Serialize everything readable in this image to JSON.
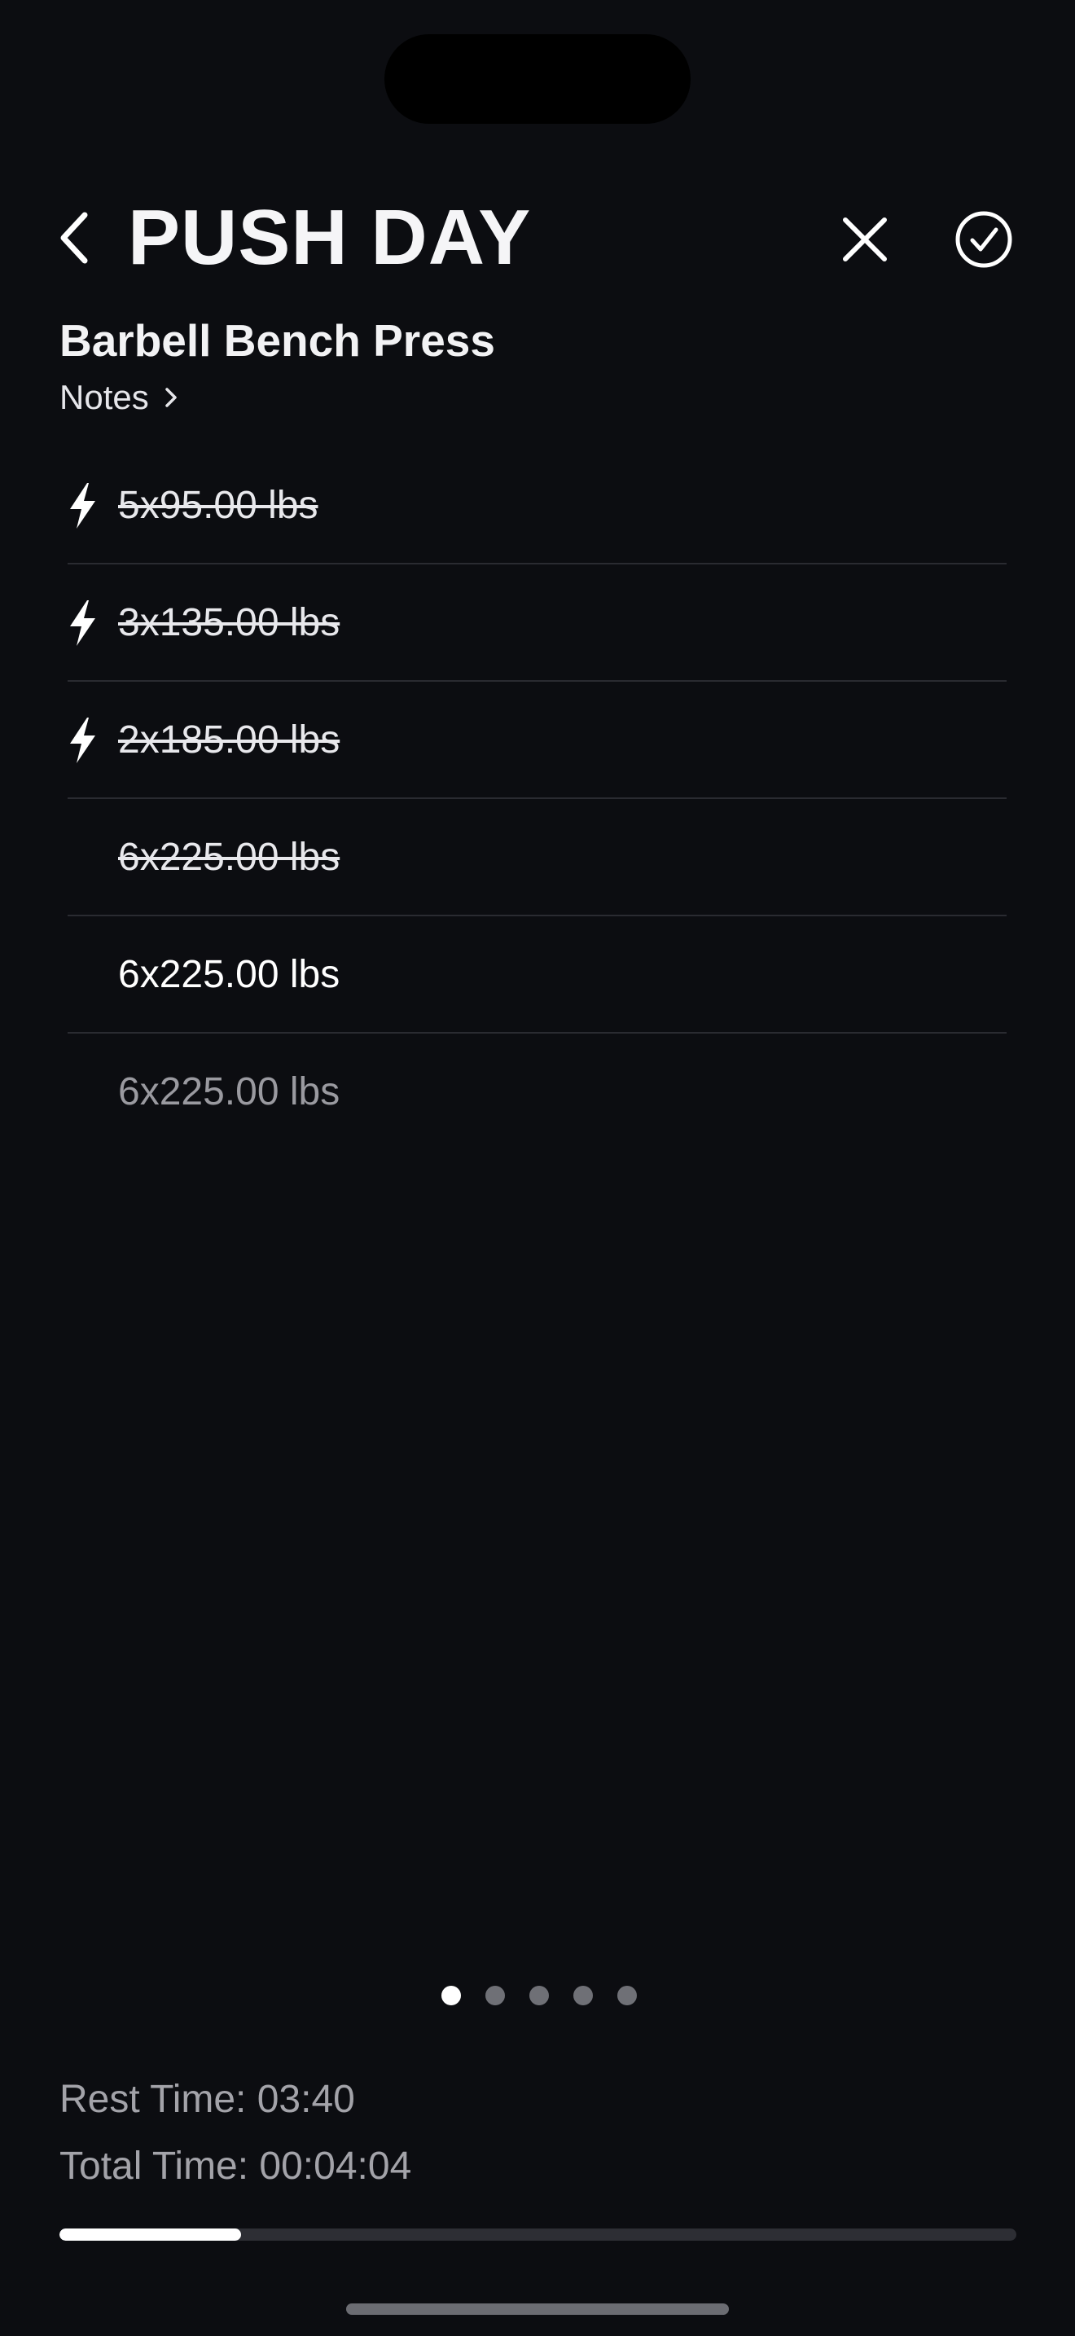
{
  "header": {
    "title": "PUSH DAY"
  },
  "exercise": {
    "name": "Barbell Bench Press",
    "notes_label": "Notes"
  },
  "sets": [
    {
      "label": "5x95.00 lbs",
      "warmup": true,
      "state": "done"
    },
    {
      "label": "3x135.00 lbs",
      "warmup": true,
      "state": "done"
    },
    {
      "label": "2x185.00 lbs",
      "warmup": true,
      "state": "done"
    },
    {
      "label": "6x225.00 lbs",
      "warmup": false,
      "state": "done"
    },
    {
      "label": "6x225.00 lbs",
      "warmup": false,
      "state": "current"
    },
    {
      "label": "6x225.00 lbs",
      "warmup": false,
      "state": "pending"
    }
  ],
  "pager": {
    "total": 5,
    "active_index": 0
  },
  "footer": {
    "rest_time": "Rest Time: 03:40",
    "total_time": "Total Time: 00:04:04"
  },
  "progress": {
    "fraction": 0.19
  },
  "icons": {
    "back": "chevron-left-icon",
    "close": "close-icon",
    "done": "checkmark-circle-icon",
    "notes": "chevron-right-icon",
    "warmup": "bolt-icon"
  }
}
